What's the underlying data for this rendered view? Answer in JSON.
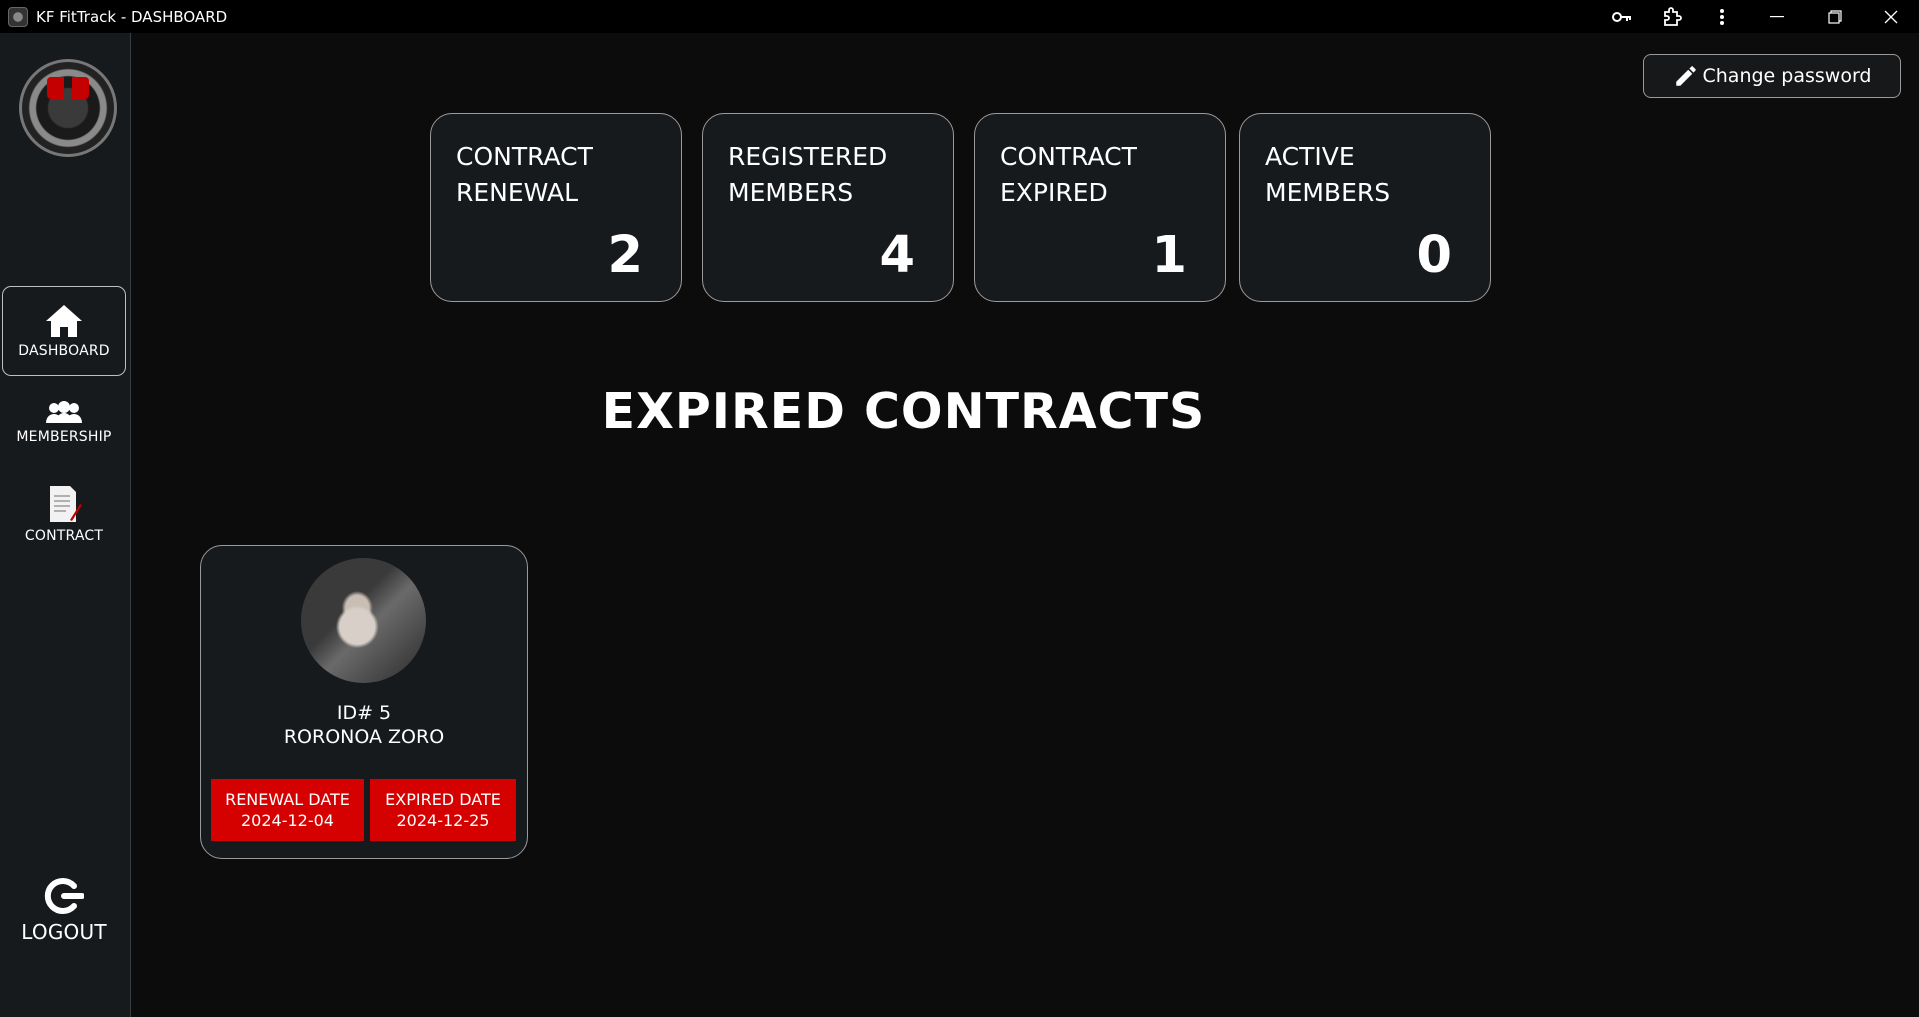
{
  "window": {
    "title": "KF FitTrack - DASHBOARD"
  },
  "sidebar": {
    "items": [
      {
        "label": "DASHBOARD",
        "icon": "home-icon",
        "active": true
      },
      {
        "label": "MEMBERSHIP",
        "icon": "users-icon",
        "active": false
      },
      {
        "label": "CONTRACT",
        "icon": "contract-icon",
        "active": false
      }
    ],
    "logout_label": "LOGOUT"
  },
  "header": {
    "change_password_label": "Change password"
  },
  "stats": [
    {
      "title": "CONTRACT\nRENEWAL",
      "value": "2"
    },
    {
      "title": "REGISTERED\nMEMBERS",
      "value": "4"
    },
    {
      "title": "CONTRACT\nEXPIRED",
      "value": "1"
    },
    {
      "title": "ACTIVE\nMEMBERS",
      "value": "0"
    }
  ],
  "section": {
    "title": "EXPIRED CONTRACTS"
  },
  "expired_contracts": [
    {
      "id_label": "ID# 5",
      "name": "RORONOA ZORO",
      "renewal_label": "RENEWAL DATE",
      "renewal_date": "2024-12-04",
      "expired_label": "EXPIRED DATE",
      "expired_date": "2024-12-25"
    }
  ],
  "colors": {
    "accent_red": "#d50000",
    "background": "#0c0c0c",
    "panel": "#171a1d"
  }
}
